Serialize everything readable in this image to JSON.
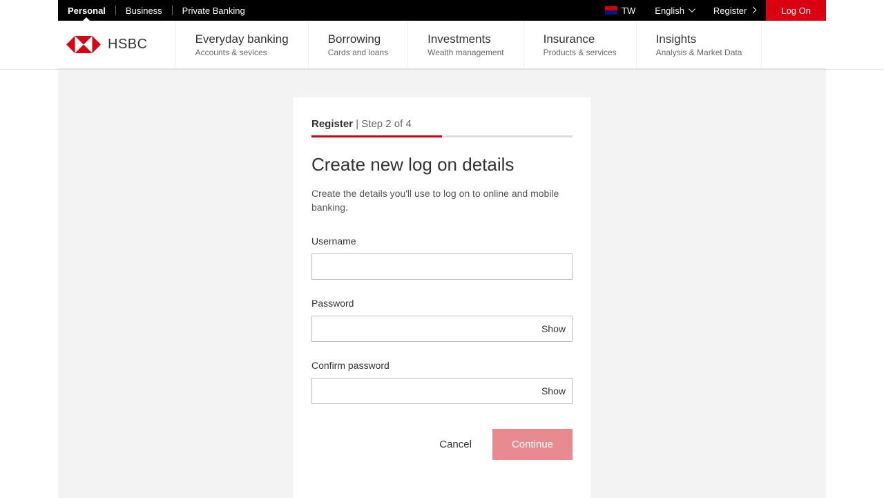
{
  "topbar": {
    "segments": [
      "Personal",
      "Business",
      "Private Banking"
    ],
    "active_segment": "Personal",
    "locale_code": "TW",
    "language_label": "English",
    "register_label": "Register",
    "logon_label": "Log On"
  },
  "brand": {
    "name": "HSBC"
  },
  "nav": [
    {
      "title": "Everyday banking",
      "sub": "Accounts & sevices"
    },
    {
      "title": "Borrowing",
      "sub": "Cards and loans"
    },
    {
      "title": "Investments",
      "sub": "Wealth management"
    },
    {
      "title": "Insurance",
      "sub": "Products & services"
    },
    {
      "title": "Insights",
      "sub": "Analysis & Market Data"
    }
  ],
  "form": {
    "step_label_bold": "Register",
    "step_separator": " | ",
    "step_label_light": "Step 2 of 4",
    "progress_percent": 50,
    "title": "Create new log on details",
    "description": "Create the details you'll use to log on to online and mobile banking.",
    "fields": {
      "username_label": "Username",
      "username_value": "",
      "password_label": "Password",
      "password_value": "",
      "confirm_label": "Confirm password",
      "confirm_value": "",
      "show_label": "Show"
    },
    "cancel_label": "Cancel",
    "continue_label": "Continue"
  },
  "colors": {
    "brand_red": "#db0011",
    "continue_disabled": "#e88a8f"
  }
}
